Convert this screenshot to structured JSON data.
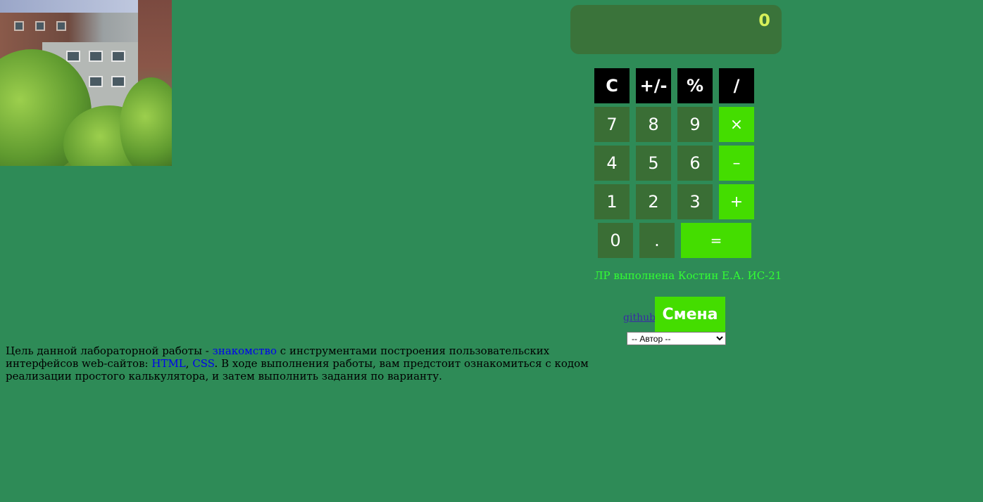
{
  "display": {
    "value": "0"
  },
  "keys": {
    "row1": [
      "C",
      "+/-",
      "%",
      "/"
    ],
    "row2": [
      "7",
      "8",
      "9",
      "×"
    ],
    "row3": [
      "4",
      "5",
      "6",
      "–"
    ],
    "row4": [
      "1",
      "2",
      "3",
      "+"
    ],
    "row5": [
      "0",
      ".",
      "="
    ]
  },
  "credit": "ЛР выполнена Костин Е.А. ИС-21",
  "github_link": "github",
  "change_button": "Смена",
  "author_select": {
    "selected": "-- Автор --",
    "options": [
      "-- Автор --"
    ]
  },
  "description": {
    "part1": "Цель данной лабораторной работы - ",
    "link1": "знакомство",
    "part2": " с инструментами построения пользовательских интерфейсов web-сайтов: ",
    "link2": "HTML",
    "sep": ", ",
    "link3": "CSS",
    "part3": ". В ходе выполнения работы, вам предстоит ознакомиться с кодом реализации простого калькулятора, и затем выполнить задания по варианту."
  },
  "colors": {
    "background": "#2e8b57",
    "display_bg": "#3a733a",
    "display_text": "#d7f05a",
    "fn_key": "#000000",
    "num_key": "#3a6e35",
    "op_key": "#44dd00",
    "credit_text": "#33ff33"
  }
}
